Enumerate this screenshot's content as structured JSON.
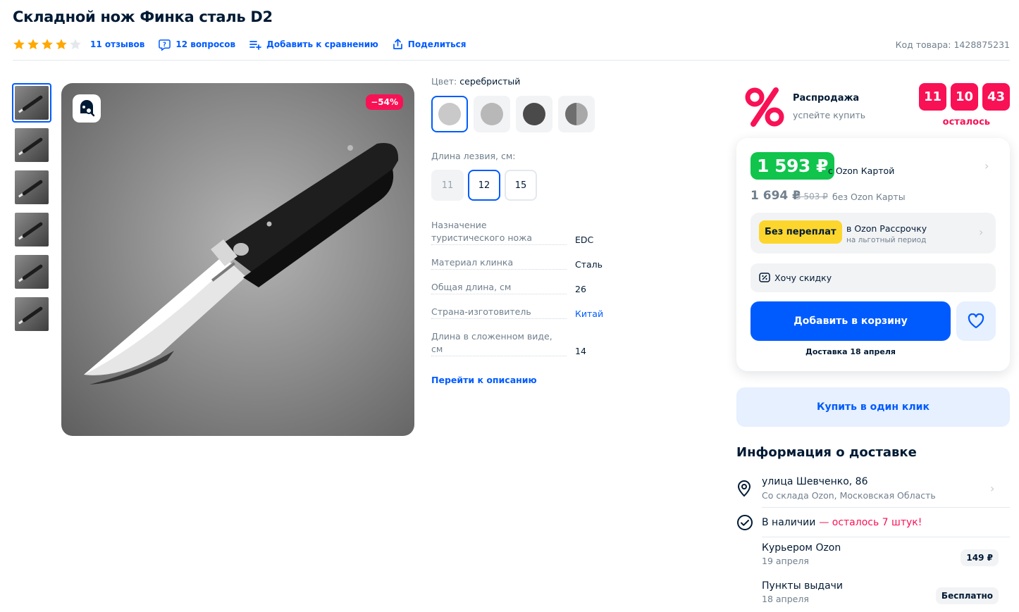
{
  "product": {
    "title": "Складной нож Финка сталь D2",
    "rating": 4,
    "reviews_label": "11 отзывов",
    "questions_label": "12 вопросов",
    "compare_label": "Добавить к сравнению",
    "share_label": "Поделиться",
    "sku_label": "Код товара: 1428875231"
  },
  "gallery": {
    "discount_badge": "−54%",
    "thumb_count": 6,
    "active_thumb": 0
  },
  "options": {
    "color_label": "Цвет:",
    "color_value": "серебристый",
    "colors": [
      "#c9c9c9",
      "#b8b8b8",
      "#4a4a4a",
      "#8c8c8c"
    ],
    "length_label": "Длина лезвия, см:",
    "lengths": [
      "11",
      "12",
      "15"
    ],
    "selected_length": "12",
    "specs": [
      {
        "name": "Назначение туристического ножа",
        "value": "EDC"
      },
      {
        "name": "Материал клинка",
        "value": "Сталь"
      },
      {
        "name": "Общая длина, см",
        "value": "26"
      },
      {
        "name": "Страна-изготовитель",
        "value": "Китай"
      },
      {
        "name": "Длина в сложенном виде, см",
        "value": "14"
      }
    ],
    "goto_description": "Перейти к описанию"
  },
  "sale": {
    "title": "Распродажа",
    "subtitle": "успейте купить",
    "timer": [
      "11",
      "10",
      "43"
    ],
    "timer_caption": "осталось"
  },
  "price": {
    "card_price": "1 593 ₽",
    "card_note": "с Ozon Картой",
    "regular_price": "1 694 ₽",
    "old_price": "3 503 ₽",
    "regular_note": "без Ozon Карты",
    "installment_badge": "Без переплат",
    "installment_title": "в Ozon Рассрочку",
    "installment_sub": "на льготный период",
    "want_discount": "Хочу скидку",
    "add_to_cart": "Добавить в корзину",
    "delivery_date": "Доставка 18 апреля",
    "one_click": "Купить в один клик"
  },
  "delivery": {
    "title": "Информация о доставке",
    "address": "улица Шевченко, 86",
    "address_sub": "Со склада Ozon, Московская Область",
    "stock": "В наличии",
    "stock_warn": "— осталось 7 штук!",
    "options": [
      {
        "title": "Курьером Ozon",
        "date": "19 апреля",
        "price": "149 ₽"
      },
      {
        "title": "Пункты выдачи",
        "date": "18 апреля",
        "price": "Бесплатно"
      }
    ]
  },
  "colors": {
    "accent": "#005bff",
    "sale": "#f91155",
    "green": "#10c44c",
    "star": "#ffa800"
  }
}
